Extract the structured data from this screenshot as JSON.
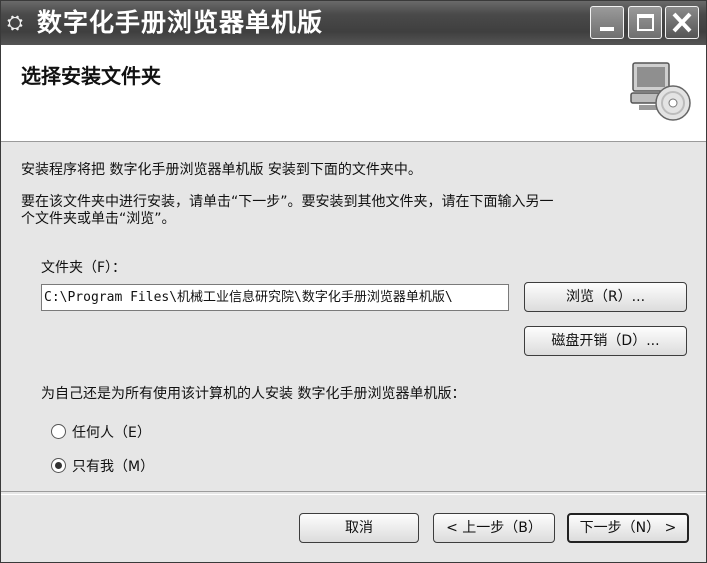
{
  "window": {
    "title": "数字化手册浏览器单机版",
    "app_icon": "setup-icon"
  },
  "header": {
    "title": "选择安装文件夹",
    "icon": "computer-cd-icon"
  },
  "intro": {
    "line1": "安装程序将把 数字化手册浏览器单机版 安装到下面的文件夹中。",
    "line2a": "要在该文件夹中进行安装，请单击“下一步”。要安装到其他文件夹，请在下面输入另一",
    "line2b": "个文件夹或单击“浏览”。"
  },
  "folder": {
    "label": "文件夹（F）：",
    "path": "C:\\Program Files\\机械工业信息研究院\\数字化手册浏览器单机版\\",
    "browse_label": "浏览（R）...",
    "disk_cost_label": "磁盘开销（D）..."
  },
  "install_for": {
    "question": "为自己还是为所有使用该计算机的人安装 数字化手册浏览器单机版：",
    "options": [
      {
        "label": "任何人（E）",
        "selected": false
      },
      {
        "label": "只有我（M）",
        "selected": true
      }
    ]
  },
  "footer": {
    "cancel_label": "取消",
    "back_label": "< 上一步（B）",
    "next_label": "下一步（N） >"
  }
}
